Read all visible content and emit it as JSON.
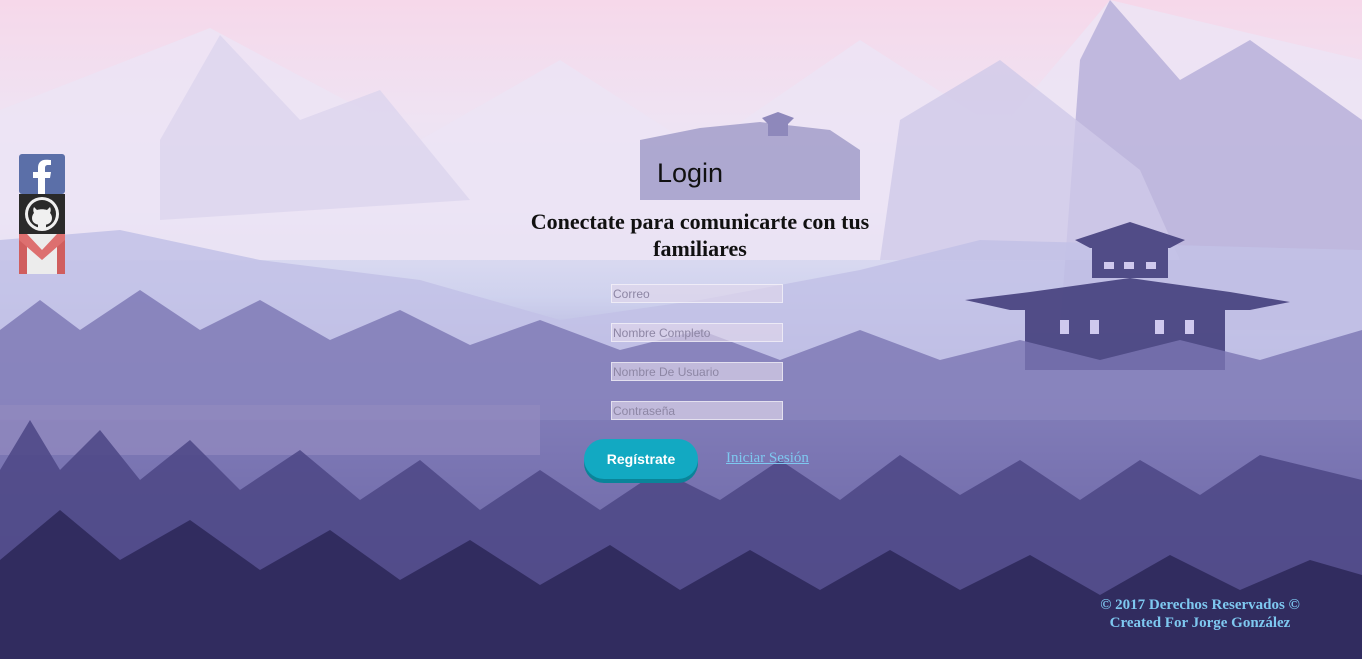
{
  "login": {
    "title": "Login",
    "subtitle": "Conectate para comunicarte con tus familiares",
    "fields": {
      "email_placeholder": "Correo",
      "fullname_placeholder": "Nombre Completo",
      "username_placeholder": "Nombre De Usuario",
      "password_placeholder": "Contraseña"
    },
    "register_label": "Regístrate",
    "signin_link": "Iniciar Sesión"
  },
  "social": {
    "icons": [
      "facebook-icon",
      "github-icon",
      "gmail-icon"
    ]
  },
  "footer": {
    "line1": "© 2017 Derechos Reservados ©",
    "line2": "Created For Jorge González"
  },
  "colors": {
    "accent_button": "#12a9c2",
    "link": "#7ec8f0",
    "sky_pink": "#f6d8ea",
    "forest_dark": "#2d2859"
  }
}
